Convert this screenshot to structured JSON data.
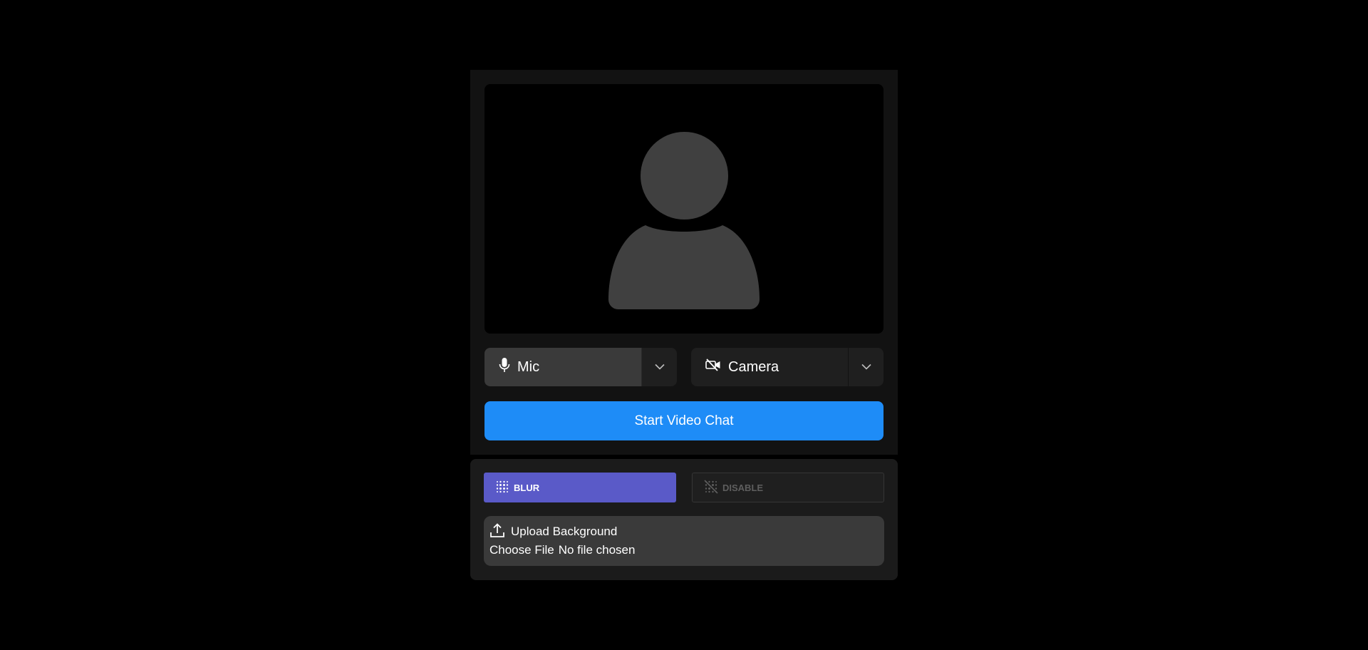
{
  "preview": {
    "avatar_color": "#404040"
  },
  "devices": {
    "mic_label": "Mic",
    "camera_label": "Camera"
  },
  "start_button_label": "Start Video Chat",
  "effects": {
    "blur_label": "BLUR",
    "disable_label": "DISABLE",
    "upload_label": "Upload Background",
    "choose_file_label": "Choose File",
    "no_file_label": "No file chosen"
  },
  "colors": {
    "start_button": "#1e8cf7",
    "blur_active": "#5a5ac8"
  }
}
